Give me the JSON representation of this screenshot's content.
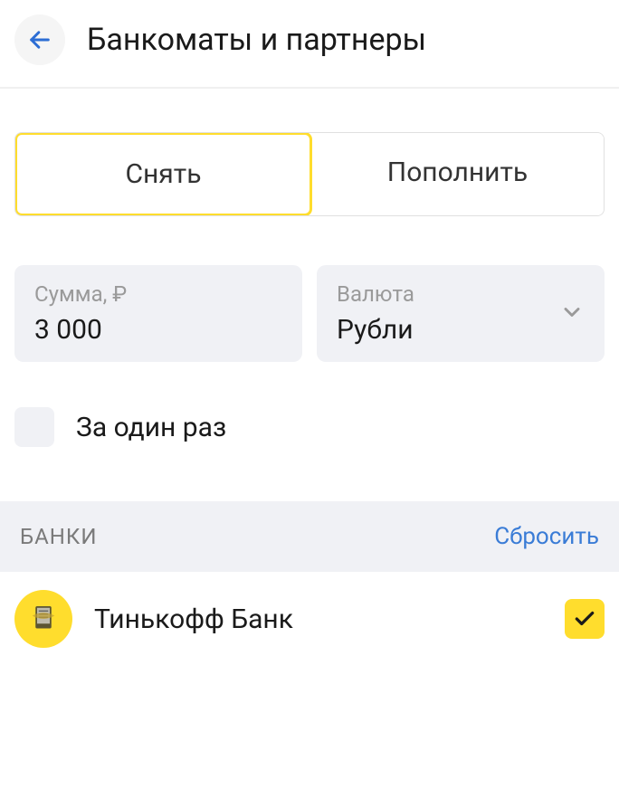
{
  "header": {
    "title": "Банкоматы и партнеры"
  },
  "tabs": {
    "withdraw": "Снять",
    "deposit": "Пополнить"
  },
  "amount": {
    "label": "Сумма, ₽",
    "value": "3 000"
  },
  "currency": {
    "label": "Валюта",
    "value": "Рубли"
  },
  "once_checkbox": {
    "label": "За один раз"
  },
  "banks_section": {
    "title": "БАНКИ",
    "reset": "Сбросить"
  },
  "bank": {
    "name": "Тинькофф Банк"
  }
}
